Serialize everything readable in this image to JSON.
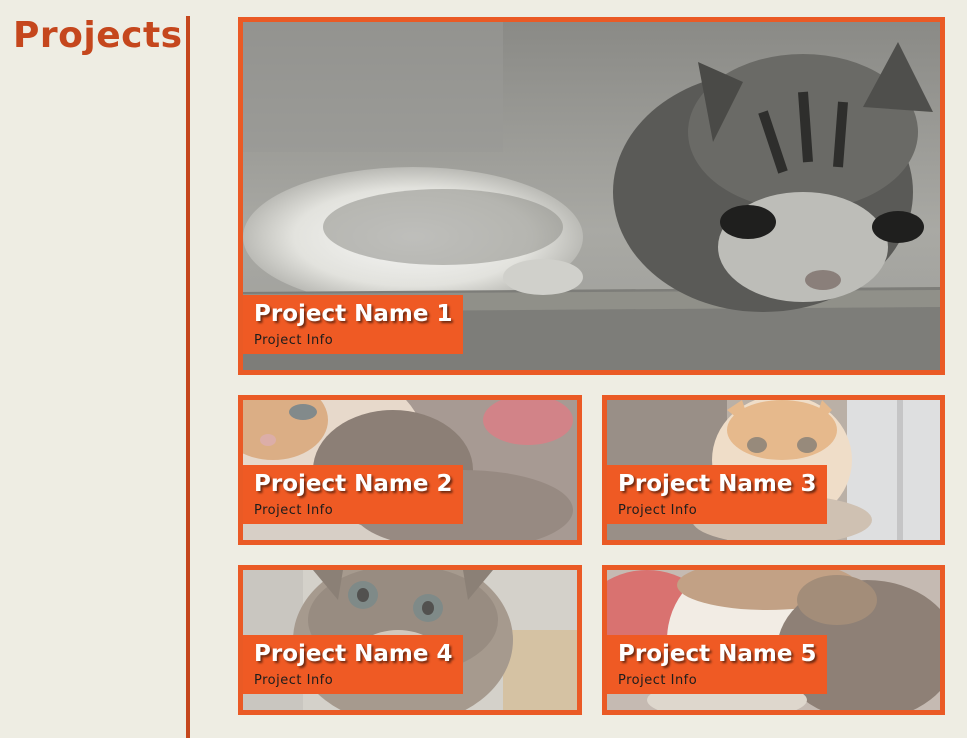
{
  "page": {
    "heading": "Projects"
  },
  "colors": {
    "background": "#eeede3",
    "accent": "#c5471d",
    "card_border": "#ea5a25",
    "caption_bg": "#ef5a24",
    "caption_title": "#ffffff",
    "caption_info": "#1d1d1d"
  },
  "projects": [
    {
      "name": "Project Name 1",
      "info": "Project Info",
      "image": "kitten-grayscale-photo"
    },
    {
      "name": "Project Name 2",
      "info": "Project Info",
      "image": "calico-kitten-photo"
    },
    {
      "name": "Project Name 3",
      "info": "Project Info",
      "image": "orange-kitten-photo"
    },
    {
      "name": "Project Name 4",
      "info": "Project Info",
      "image": "tabby-kitten-photo"
    },
    {
      "name": "Project Name 5",
      "info": "Project Info",
      "image": "white-orange-kitten-photo"
    }
  ]
}
